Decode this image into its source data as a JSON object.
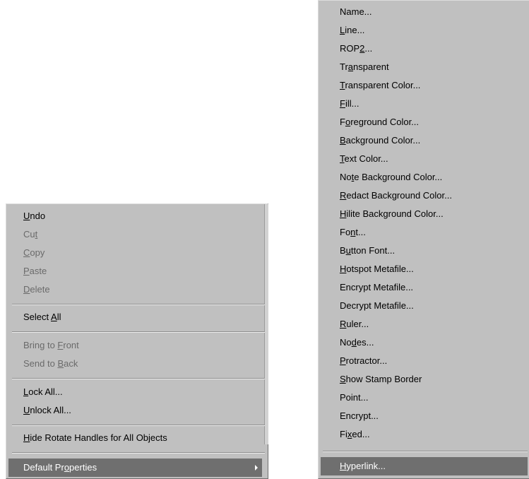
{
  "context_menu": {
    "items": [
      {
        "pre": "",
        "key": "U",
        "post": "ndo",
        "disabled": false
      },
      {
        "pre": "Cu",
        "key": "t",
        "post": "",
        "disabled": true
      },
      {
        "pre": "",
        "key": "C",
        "post": "opy",
        "disabled": true
      },
      {
        "pre": "",
        "key": "P",
        "post": "aste",
        "disabled": true
      },
      {
        "pre": "",
        "key": "D",
        "post": "elete",
        "disabled": true
      },
      {
        "pre": "Select ",
        "key": "A",
        "post": "ll",
        "disabled": false
      },
      {
        "pre": "Bring to ",
        "key": "F",
        "post": "ront",
        "disabled": true
      },
      {
        "pre": "Send to ",
        "key": "B",
        "post": "ack",
        "disabled": true
      },
      {
        "pre": "",
        "key": "L",
        "post": "ock All...",
        "disabled": false
      },
      {
        "pre": "",
        "key": "U",
        "post": "nlock All...",
        "disabled": false
      },
      {
        "pre": "",
        "key": "H",
        "post": "ide Rotate Handles for All Objects",
        "disabled": false
      },
      {
        "pre": "Default Pr",
        "key": "o",
        "post": "perties",
        "disabled": false,
        "highlighted": true,
        "submenu": true
      }
    ]
  },
  "properties_submenu": {
    "items": [
      {
        "pre": "Name...",
        "key": "",
        "post": ""
      },
      {
        "pre": "",
        "key": "L",
        "post": "ine..."
      },
      {
        "pre": "ROP",
        "key": "2",
        "post": "..."
      },
      {
        "pre": "Tr",
        "key": "a",
        "post": "nsparent"
      },
      {
        "pre": "",
        "key": "T",
        "post": "ransparent Color..."
      },
      {
        "pre": "",
        "key": "F",
        "post": "ill..."
      },
      {
        "pre": "F",
        "key": "o",
        "post": "reground Color..."
      },
      {
        "pre": "",
        "key": "B",
        "post": "ackground Color..."
      },
      {
        "pre": "",
        "key": "T",
        "post": "ext Color..."
      },
      {
        "pre": "No",
        "key": "t",
        "post": "e Background Color..."
      },
      {
        "pre": "",
        "key": "R",
        "post": "edact Background Color..."
      },
      {
        "pre": "",
        "key": "H",
        "post": "ilite Background Color..."
      },
      {
        "pre": "Fo",
        "key": "n",
        "post": "t..."
      },
      {
        "pre": "B",
        "key": "u",
        "post": "tton Font..."
      },
      {
        "pre": "",
        "key": "H",
        "post": "otspot Metafile..."
      },
      {
        "pre": "Encrypt Metafile...",
        "key": "",
        "post": ""
      },
      {
        "pre": "Decrypt Metafile...",
        "key": "",
        "post": ""
      },
      {
        "pre": "",
        "key": "R",
        "post": "uler..."
      },
      {
        "pre": "No",
        "key": "d",
        "post": "es..."
      },
      {
        "pre": "",
        "key": "P",
        "post": "rotractor..."
      },
      {
        "pre": "",
        "key": "S",
        "post": "how Stamp Border"
      },
      {
        "pre": "Point...",
        "key": "",
        "post": ""
      },
      {
        "pre": "Encrypt...",
        "key": "",
        "post": ""
      },
      {
        "pre": "Fi",
        "key": "x",
        "post": "ed..."
      },
      {
        "pre": "",
        "key": "H",
        "post": "yperlink...",
        "highlighted": true
      }
    ]
  },
  "colors": {
    "menu_bg": "#c0c0c0",
    "highlight_bg": "#6f6f6f",
    "disabled_text": "#6a6a6a"
  }
}
